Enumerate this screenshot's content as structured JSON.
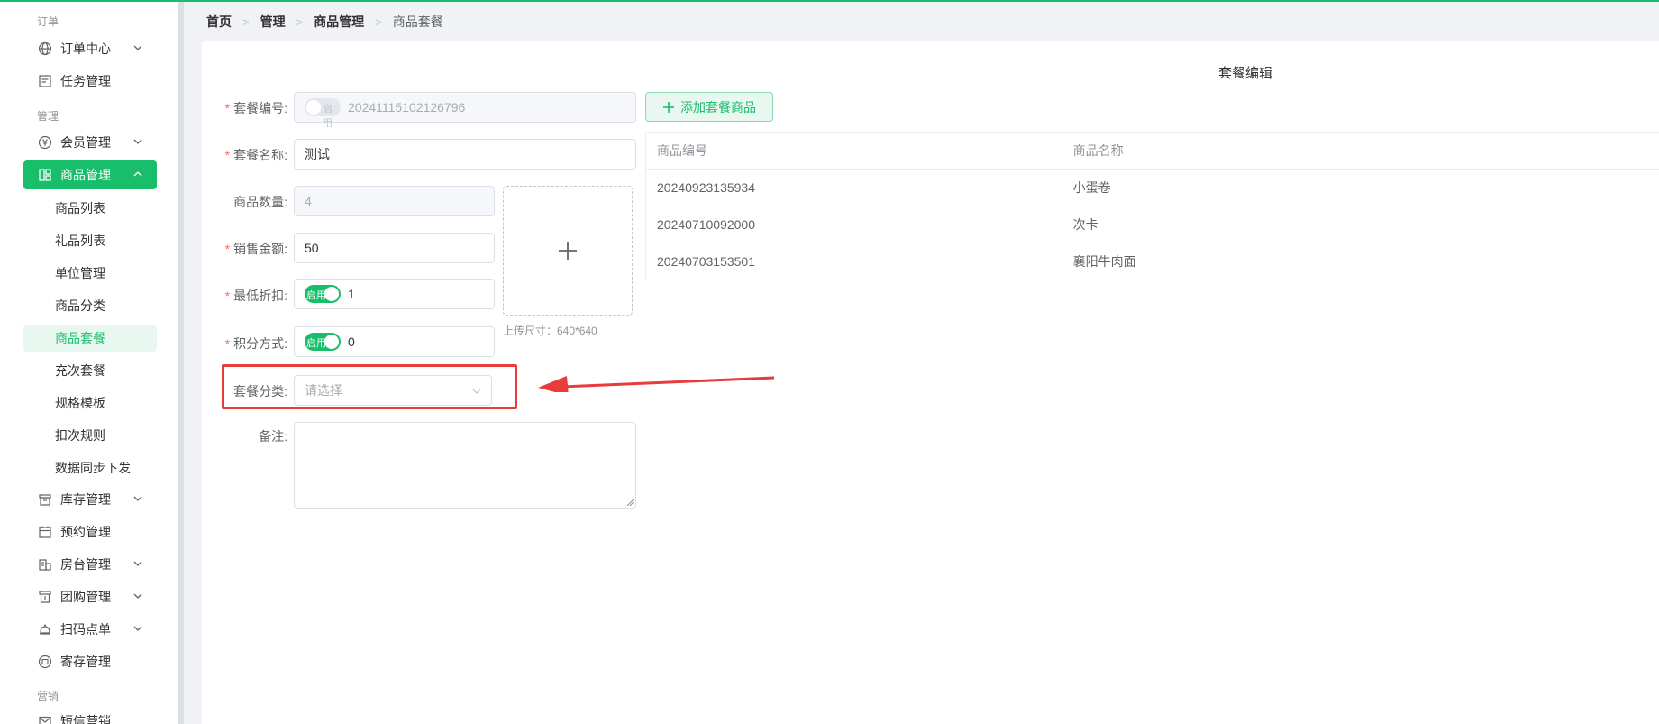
{
  "sidebar": {
    "sections": [
      {
        "label": "订单"
      },
      {
        "label": "管理"
      },
      {
        "label": "营销"
      }
    ],
    "items": {
      "order_center": {
        "label": "订单中心",
        "icon": "globe-icon"
      },
      "task_mgmt": {
        "label": "任务管理",
        "icon": "list-icon"
      },
      "member_mgmt": {
        "label": "会员管理",
        "icon": "yen-circle-icon"
      },
      "product_mgmt": {
        "label": "商品管理",
        "icon": "grid-icon"
      },
      "inventory_mgmt": {
        "label": "库存管理",
        "icon": "box-icon"
      },
      "booking_mgmt": {
        "label": "预约管理",
        "icon": "calendar-icon"
      },
      "room_mgmt": {
        "label": "房台管理",
        "icon": "building-icon"
      },
      "group_mgmt": {
        "label": "团购管理",
        "icon": "tag-icon"
      },
      "scan_order": {
        "label": "扫码点单",
        "icon": "bell-icon"
      },
      "deposit_mgmt": {
        "label": "寄存管理",
        "icon": "deposit-icon"
      },
      "sms_marketing": {
        "label": "短信营销",
        "icon": "mail-icon"
      }
    },
    "sub_items": [
      {
        "label": "商品列表"
      },
      {
        "label": "礼品列表"
      },
      {
        "label": "单位管理"
      },
      {
        "label": "商品分类"
      },
      {
        "label": "商品套餐"
      },
      {
        "label": "充次套餐"
      },
      {
        "label": "规格模板"
      },
      {
        "label": "扣次规则"
      },
      {
        "label": "数据同步下发"
      }
    ]
  },
  "breadcrumb": {
    "items": [
      "首页",
      "管理",
      "商品管理",
      "商品套餐"
    ]
  },
  "page": {
    "title": "套餐编辑"
  },
  "form": {
    "package_no": {
      "label": "套餐编号:",
      "value": "20241115102126796",
      "switch_text": "启用",
      "required": true
    },
    "package_name": {
      "label": "套餐名称:",
      "value": "测试",
      "required": true
    },
    "product_count": {
      "label": "商品数量:",
      "value": "4"
    },
    "sale_amount": {
      "label": "销售金额:",
      "value": "50",
      "required": true
    },
    "min_discount": {
      "label": "最低折扣:",
      "value": "1",
      "switch_text": "启用",
      "required": true
    },
    "points_mode": {
      "label": "积分方式:",
      "value": "0",
      "switch_text": "启用",
      "required": true
    },
    "package_category": {
      "label": "套餐分类:",
      "placeholder": "请选择"
    },
    "remark": {
      "label": "备注:"
    },
    "required_mark": "*"
  },
  "upload": {
    "hint": "上传尺寸：640*640"
  },
  "products": {
    "add_button": "添加套餐商品",
    "columns": [
      "商品编号",
      "商品名称"
    ],
    "rows": [
      {
        "code": "20240923135934",
        "name": "小蛋卷"
      },
      {
        "code": "20240710092000",
        "name": "次卡"
      },
      {
        "code": "20240703153501",
        "name": "襄阳牛肉面"
      }
    ]
  },
  "colors": {
    "accent": "#19be6b",
    "highlight": "#e83b3b"
  }
}
